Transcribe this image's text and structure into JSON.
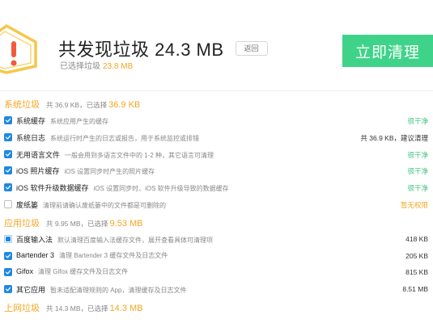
{
  "header": {
    "title": "共发现垃圾 24.3 MB",
    "back_label": "返回",
    "subtitle_prefix": "已选择垃圾",
    "subtitle_amount": "23.8 MB",
    "clean_button": "立即清理"
  },
  "colors": {
    "accent_orange": "#f5a623",
    "accent_green": "#3fd38a",
    "checkbox_blue": "#1e88e5"
  },
  "categories": [
    {
      "name": "系统垃圾",
      "stat_prefix": "共 36.9 KB，已选择",
      "stat_selected": "36.9 KB",
      "items": [
        {
          "name": "系统缓存",
          "desc": "系统应用产生的缓存",
          "status": "很干净",
          "status_type": "clean",
          "checked": "checked"
        },
        {
          "name": "系统日志",
          "desc": "系统运行时产生的日志或报告，用于系统监控或排错",
          "status": "共 36.9 KB，建议清理",
          "status_type": "size",
          "checked": "checked"
        },
        {
          "name": "无用语言文件",
          "desc": "一般会用到多语言文件中的 1-2 种，其它语言可清理",
          "status": "很干净",
          "status_type": "clean",
          "checked": "checked"
        },
        {
          "name": "iOS 照片缓存",
          "desc": "iOS 设置同步时产生的照片缓存",
          "status": "很干净",
          "status_type": "clean",
          "checked": "checked"
        },
        {
          "name": "iOS 软件升级数据缓存",
          "desc": "iOS 设置同步时、iOS 软件升级导致的数据缓存",
          "status": "很干净",
          "status_type": "clean",
          "checked": "checked"
        },
        {
          "name": "废纸篓",
          "desc": "清理前请确认废纸篓中的文件都是可删除的",
          "status": "暂无权限",
          "status_type": "noperm",
          "checked": "empty"
        }
      ]
    },
    {
      "name": "应用垃圾",
      "stat_prefix": "共 9.95 MB，已选择",
      "stat_selected": "9.53 MB",
      "items": [
        {
          "name": "百度输入法",
          "desc": "默认清理百度输入法缓存文件，展开查看具体可清理项",
          "status": "418 KB",
          "status_type": "size",
          "checked": "partial"
        },
        {
          "name": "Bartender 3",
          "desc": "清理 Bartender 3 缓存文件及日志文件",
          "status": "205 KB",
          "status_type": "size",
          "checked": "checked"
        },
        {
          "name": "Gifox",
          "desc": "清理 Gifox 缓存文件及日志文件",
          "status": "815 KB",
          "status_type": "size",
          "checked": "checked"
        },
        {
          "name": "其它应用",
          "desc": "暂未适配清理规则的 App，清理缓存及日志文件",
          "status": "8.51 MB",
          "status_type": "size",
          "checked": "checked"
        }
      ]
    },
    {
      "name": "上网垃圾",
      "stat_prefix": "共 14.3 MB，已选择",
      "stat_selected": "14.3 MB",
      "items": []
    }
  ]
}
